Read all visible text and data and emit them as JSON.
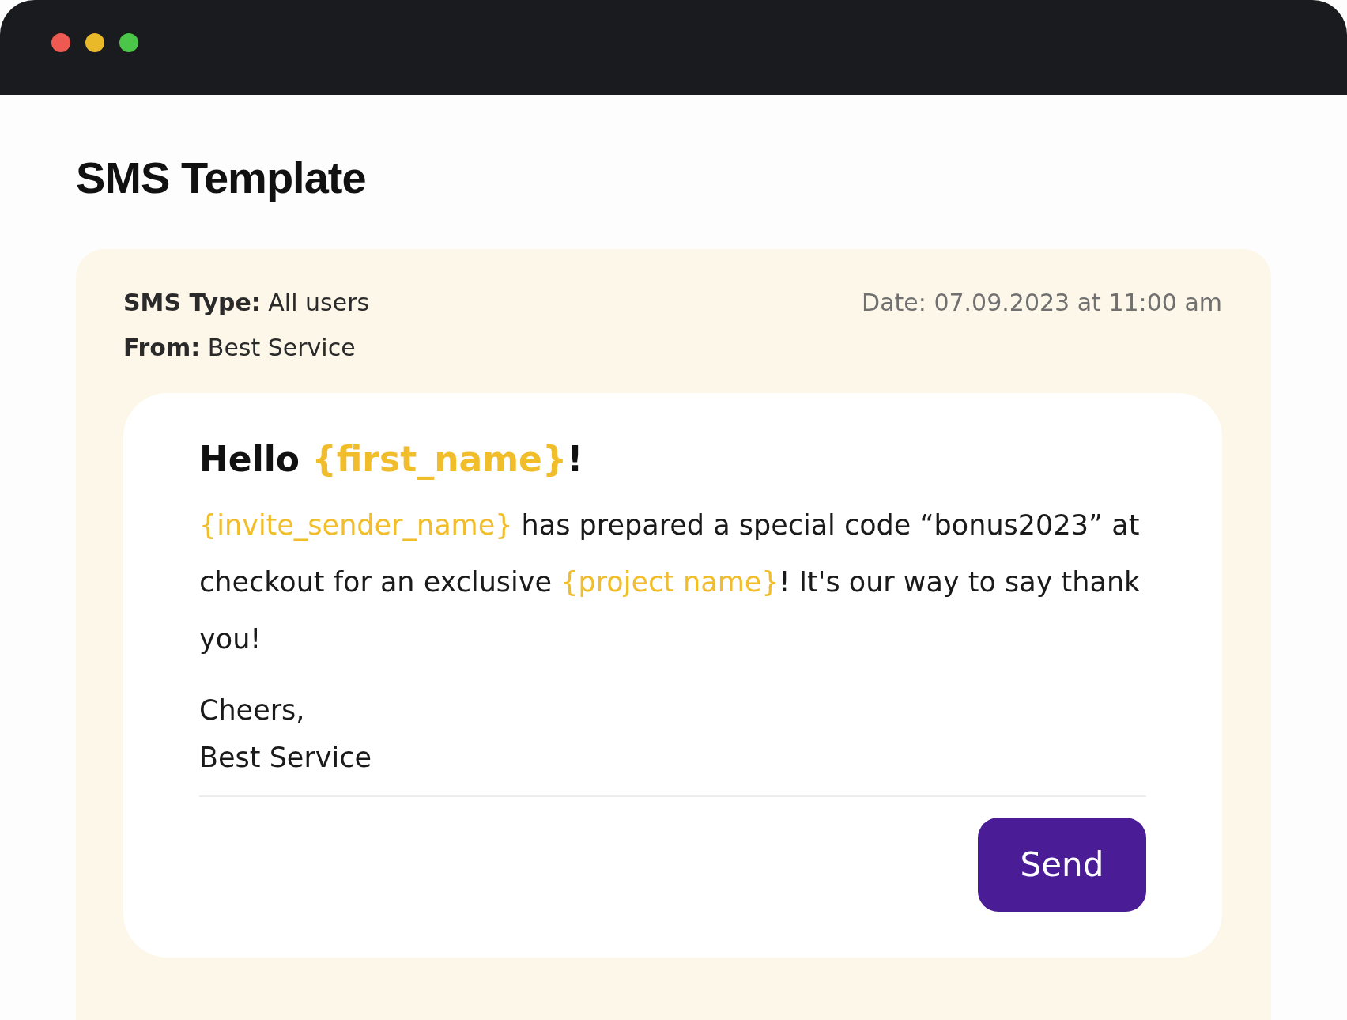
{
  "page": {
    "title": "SMS Template"
  },
  "meta": {
    "type": {
      "label": "SMS Type:",
      "value": "All users"
    },
    "from": {
      "label": "From:",
      "value": "Best Service"
    },
    "date": "Date: 07.09.2023 at 11:00 am"
  },
  "message": {
    "greeting": [
      {
        "kind": "text",
        "text": "Hello "
      },
      {
        "kind": "variable",
        "text": "{first_name}"
      },
      {
        "kind": "text",
        "text": "!"
      }
    ],
    "body": [
      {
        "kind": "variable",
        "text": "{invite_sender_name}"
      },
      {
        "kind": "text",
        "text": " has prepared a special code “bonus2023” at checkout for an exclusive "
      },
      {
        "kind": "variable",
        "text": "{project name}"
      },
      {
        "kind": "text",
        "text": "! It's our way to say thank you!"
      }
    ],
    "signoff": "Cheers,",
    "signature": "Best Service"
  },
  "send_button": "Send"
}
